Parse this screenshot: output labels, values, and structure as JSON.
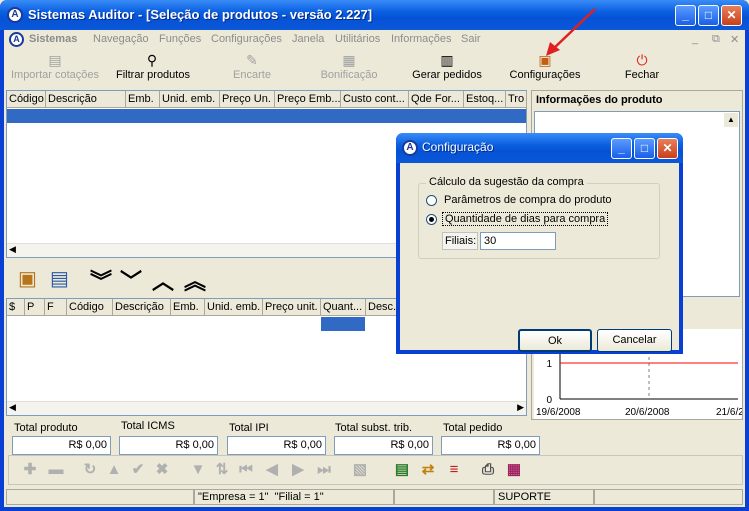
{
  "window": {
    "title": "Sistemas Auditor - [Seleção de produtos - versão 2.227]",
    "icon_glyph": "A"
  },
  "menu": {
    "app": "Sistemas",
    "items": [
      "Navegação",
      "Funções",
      "Configurações",
      "Janela",
      "Utilitários",
      "Informações",
      "Sair"
    ]
  },
  "toolbar": {
    "import": "Importar cotações",
    "filter": "Filtrar produtos",
    "encarte": "Encarte",
    "bonificacao": "Bonificação",
    "gerar": "Gerar pedidos",
    "config": "Configurações",
    "fechar": "Fechar"
  },
  "products_grid": {
    "columns": [
      "Código",
      "Descrição",
      "Emb.",
      "Unid. emb.",
      "Preço Un.",
      "Preço Emb...",
      "Custo cont...",
      "Qde For...",
      "Estoq...",
      "Tro"
    ]
  },
  "info_panel": {
    "title": "Informações do produto"
  },
  "chart_data": {
    "type": "line",
    "x_labels": [
      "19/6/2008",
      "20/6/2008",
      "21/6/2"
    ],
    "y_ticks": [
      "1",
      "0"
    ],
    "series": [
      {
        "values": [
          1,
          1,
          1
        ]
      }
    ],
    "colors": {
      "line": "#ff0000"
    }
  },
  "order_grid": {
    "columns": [
      "$",
      "P",
      "F",
      "Código",
      "Descrição",
      "Emb.",
      "Unid. emb.",
      "Preço unit.",
      "Quant...",
      "Desc..."
    ]
  },
  "totals": [
    {
      "label": "Total produto",
      "value": "R$ 0,00"
    },
    {
      "label": "Total ICMS",
      "value": "R$ 0,00"
    },
    {
      "label": "Total IPI",
      "value": "R$ 0,00"
    },
    {
      "label": "Total subst. trib.",
      "value": "R$ 0,00"
    },
    {
      "label": "Total pedido",
      "value": "R$ 0,00"
    }
  ],
  "status": {
    "empresa": "\"Empresa = 1\"",
    "filial": "\"Filial = 1\"",
    "user": "SUPORTE"
  },
  "dialog": {
    "title": "Configuração",
    "group": "Cálculo da sugestão da compra",
    "option1": "Parâmetros de compra do produto",
    "option2": "Quantidade de dias para compra",
    "filiais_label": "Filiais:",
    "filiais_value": "30",
    "ok": "Ok",
    "cancel": "Cancelar"
  },
  "colors": {
    "title_bar": "#0a5fe0",
    "selection": "#316ac5",
    "arrow": "#e02020"
  }
}
